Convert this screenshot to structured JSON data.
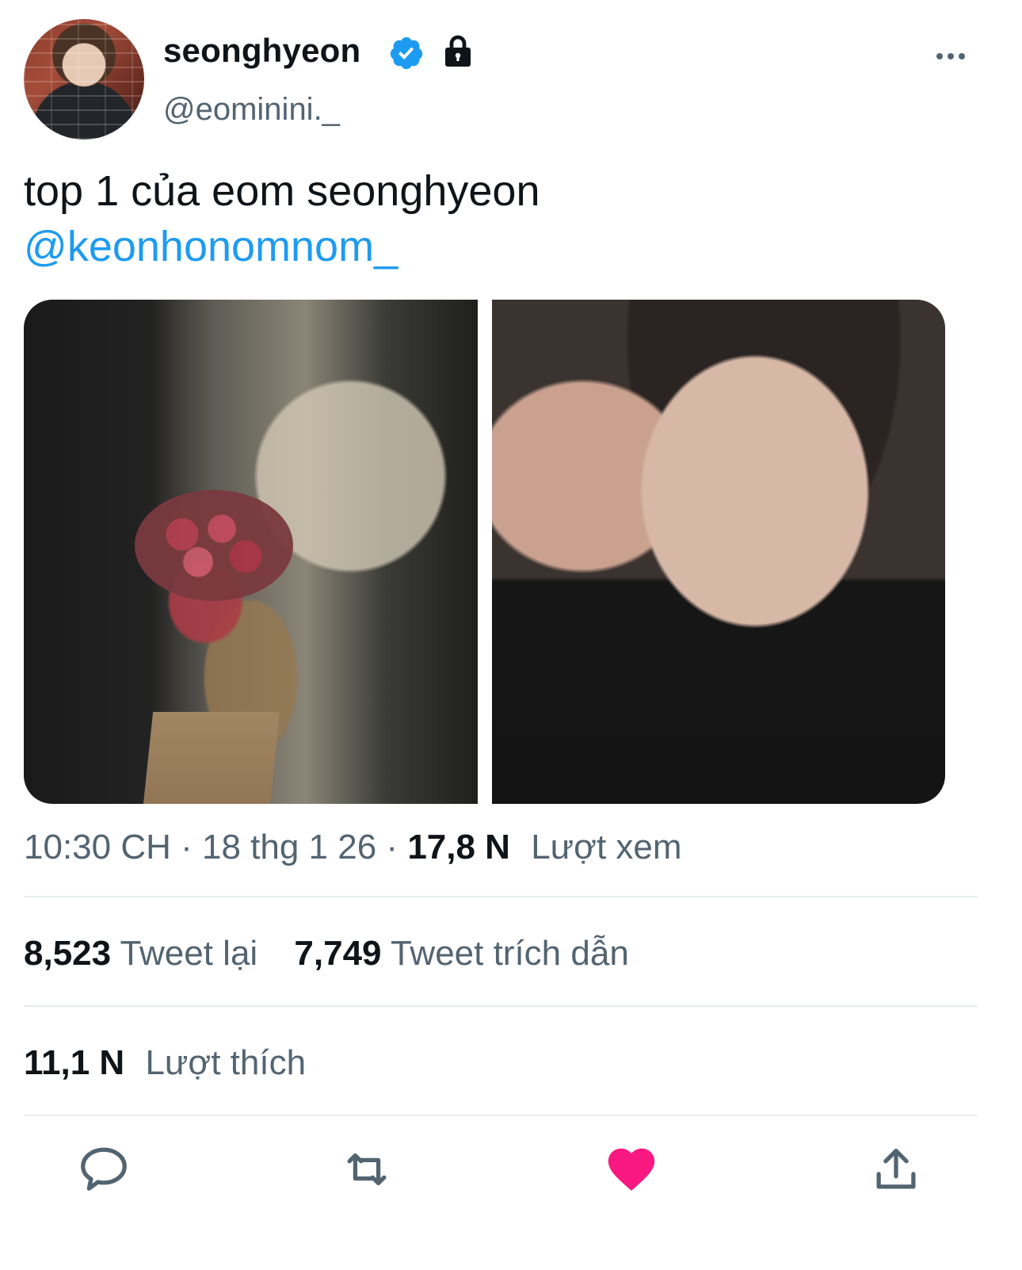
{
  "author": {
    "display_name": "seonghyeon",
    "handle": "@eominini._",
    "verified_icon": "verified-badge-icon",
    "lock_icon": "lock-icon"
  },
  "tweet": {
    "text_line1": "top 1 của eom seonghyeon",
    "mention": "@keonhonomnom_"
  },
  "meta": {
    "time": "10:30 CH",
    "sep1": " · ",
    "date": "18 thg 1 26",
    "sep2": " · ",
    "views_count": "17,8 N",
    "views_label": "Lượt xem"
  },
  "stats": {
    "retweets_count": "8,523",
    "retweets_label": "Tweet lại",
    "quotes_count": "7,749",
    "quotes_label": "Tweet trích dẫn",
    "likes_count": "11,1 N",
    "likes_label": "Lượt thích"
  },
  "actions": [
    "reply-icon",
    "retweet-icon",
    "heart-icon",
    "share-icon"
  ],
  "colors": {
    "accent": "#1d9bf0",
    "like": "#f91880",
    "secondary_text": "#536471",
    "divider": "#e6ecf0"
  }
}
